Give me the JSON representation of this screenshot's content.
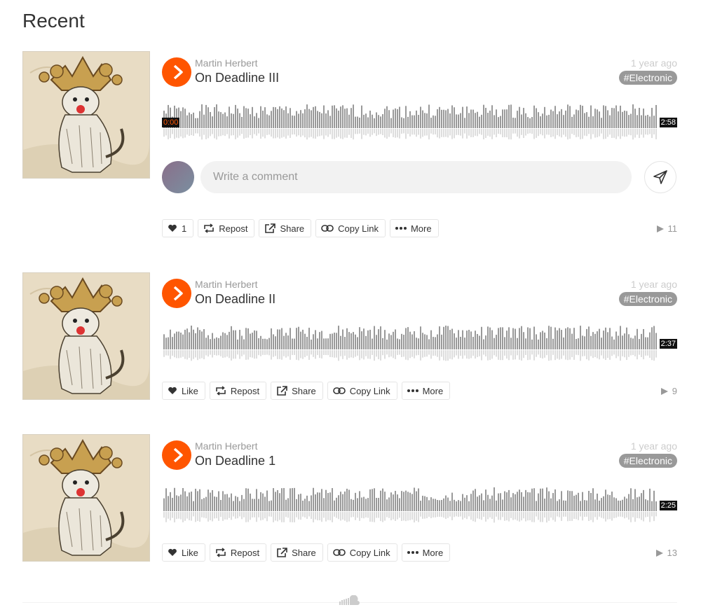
{
  "page": {
    "title": "Recent"
  },
  "comment": {
    "placeholder": "Write a comment"
  },
  "tracks": [
    {
      "artist": "Martin Herbert",
      "title": "On Deadline III",
      "time_ago": "1 year ago",
      "tag": "#Electronic",
      "current_time": "0:00",
      "duration": "2:58",
      "like_label": "1",
      "repost_label": "Repost",
      "share_label": "Share",
      "copy_link_label": "Copy Link",
      "more_label": "More",
      "plays": "11"
    },
    {
      "artist": "Martin Herbert",
      "title": "On Deadline II",
      "time_ago": "1 year ago",
      "tag": "#Electronic",
      "duration": "2:37",
      "like_label": "Like",
      "repost_label": "Repost",
      "share_label": "Share",
      "copy_link_label": "Copy Link",
      "more_label": "More",
      "plays": "9"
    },
    {
      "artist": "Martin Herbert",
      "title": "On Deadline 1",
      "time_ago": "1 year ago",
      "tag": "#Electronic",
      "duration": "2:25",
      "like_label": "Like",
      "repost_label": "Repost",
      "share_label": "Share",
      "copy_link_label": "Copy Link",
      "more_label": "More",
      "plays": "13"
    }
  ],
  "colors": {
    "accent": "#ff5500",
    "waveform": "#999999",
    "tag_bg": "#999999"
  },
  "icons": [
    "play-icon",
    "heart-icon",
    "repost-icon",
    "share-icon",
    "link-icon",
    "more-icon",
    "send-icon",
    "play-count-icon",
    "soundcloud-logo-icon"
  ]
}
